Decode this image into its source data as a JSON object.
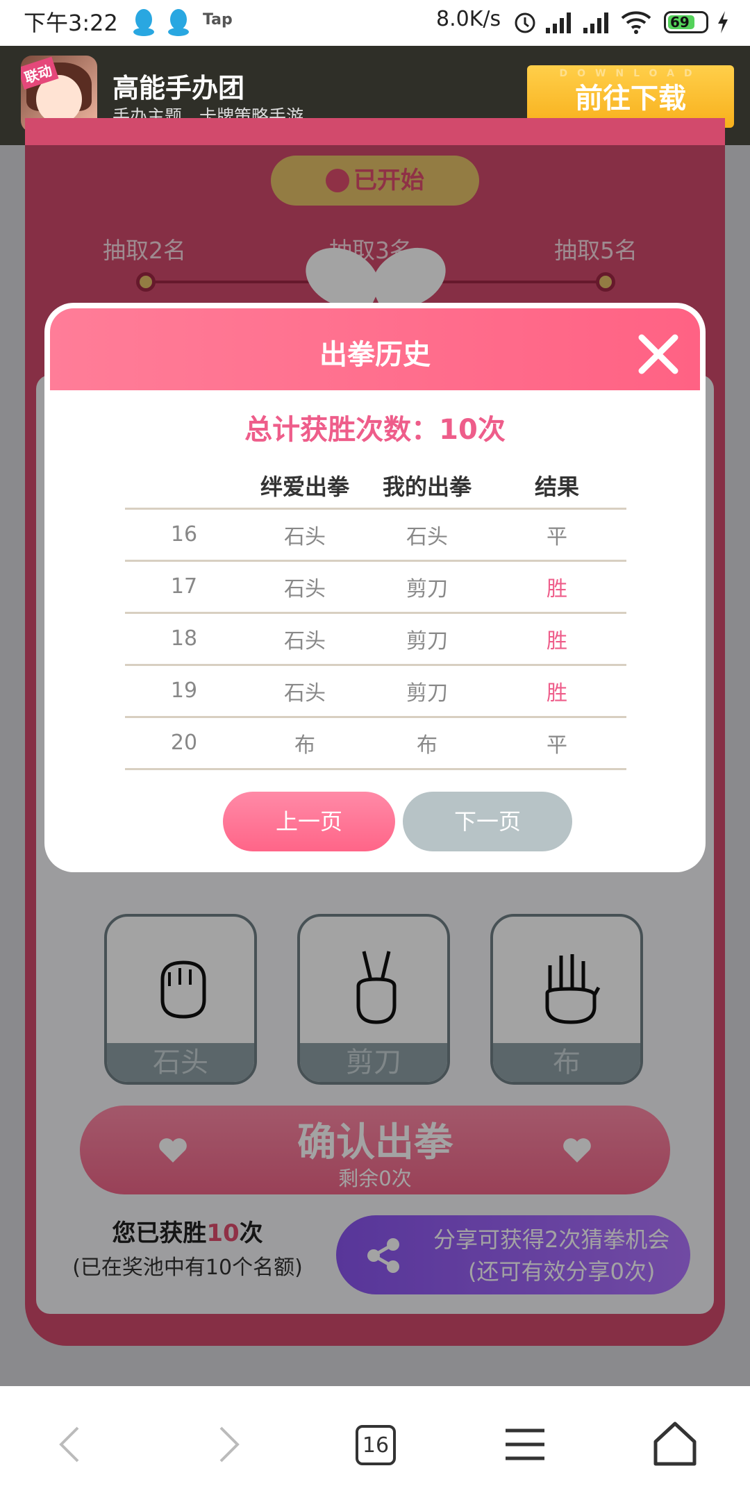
{
  "status_bar": {
    "time": "下午3:22",
    "tap_label": "Tap",
    "net_speed": "8.0K/s",
    "battery": "69"
  },
  "ad": {
    "badge": "联动",
    "title": "高能手办团",
    "subtitle": "手办主题，卡牌策略手游",
    "download_watermark": "DOWNLOAD",
    "download_label": "前往下载"
  },
  "activity": {
    "status": "已开始",
    "prizes": [
      "抽取2名",
      "抽取3名",
      "抽取5名"
    ],
    "choices": [
      "石头",
      "剪刀",
      "布"
    ],
    "confirm_label": "确认出拳",
    "remaining": "剩余0次",
    "wins_prefix": "您已获胜",
    "wins_count": "10",
    "wins_suffix": "次",
    "pool_note": "(已在奖池中有10个名额)",
    "share_line1": "分享可获得2次猜拳机会",
    "share_line2": "(还可有效分享0次)"
  },
  "modal": {
    "title": "出拳历史",
    "total": "总计获胜次数：10次",
    "columns": [
      "",
      "绊爱出拳",
      "我的出拳",
      "结果"
    ],
    "rows": [
      [
        "16",
        "石头",
        "石头",
        "平"
      ],
      [
        "17",
        "石头",
        "剪刀",
        "胜"
      ],
      [
        "18",
        "石头",
        "剪刀",
        "胜"
      ],
      [
        "19",
        "石头",
        "剪刀",
        "胜"
      ],
      [
        "20",
        "布",
        "布",
        "平"
      ]
    ],
    "prev_label": "上一页",
    "next_label": "下一页"
  },
  "nav": {
    "tab_count": "16"
  },
  "colors": {
    "accent_pink": "#ff6284",
    "win_pink": "#ee5d8a",
    "frame_red": "#d24a6c",
    "share_purple": "#8a55f0",
    "gold": "#e7c36a"
  }
}
